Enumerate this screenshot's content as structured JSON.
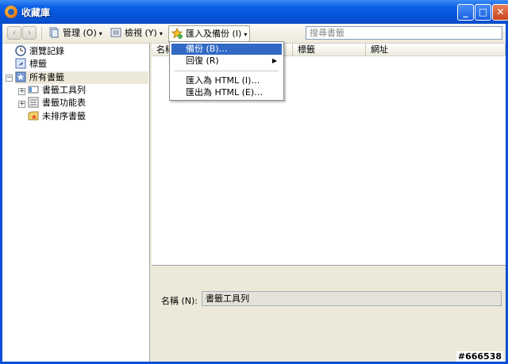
{
  "window": {
    "title": "收藏庫"
  },
  "toolbar": {
    "back_glyph": "‹",
    "forward_glyph": "›",
    "manage_label": "管理 (O)",
    "view_label": "檢視 (Y)",
    "import_backup_label": "匯入及備份 (I)",
    "search_placeholder": "搜尋書籤",
    "dropdown_glyph": "▾"
  },
  "sidebar": {
    "items": [
      {
        "label": "瀏覽記錄",
        "icon": "history-clock-icon"
      },
      {
        "label": "標籤",
        "icon": "tag-icon"
      },
      {
        "label": "所有書籤",
        "icon": "all-bookmarks-icon",
        "expander": "−"
      },
      {
        "label": "書籤工具列",
        "icon": "bookmarks-toolbar-icon",
        "expander": "+"
      },
      {
        "label": "書籤功能表",
        "icon": "bookmarks-menu-icon",
        "expander": "+"
      },
      {
        "label": "未排序書籤",
        "icon": "unsorted-bookmarks-icon"
      }
    ]
  },
  "list": {
    "columns": [
      "名稱",
      "標籤",
      "網址"
    ]
  },
  "details": {
    "name_label": "名稱 (N):",
    "name_value": "書籤工具列"
  },
  "dropdown_menu": {
    "items": [
      {
        "label": "備份 (B)…",
        "highlighted": true
      },
      {
        "label": "回復 (R)",
        "submenu_glyph": "▶"
      },
      {
        "label": "匯入為 HTML (I)…"
      },
      {
        "label": "匯出為 HTML (E)…"
      }
    ]
  },
  "titlebar_buttons": {
    "minimize": "_",
    "maximize": "□",
    "close": "✕"
  },
  "watermark": "#666538",
  "colors": {
    "titlebar": "#0a5ee6",
    "highlight": "#316ac5",
    "frame": "#ece9d8"
  }
}
